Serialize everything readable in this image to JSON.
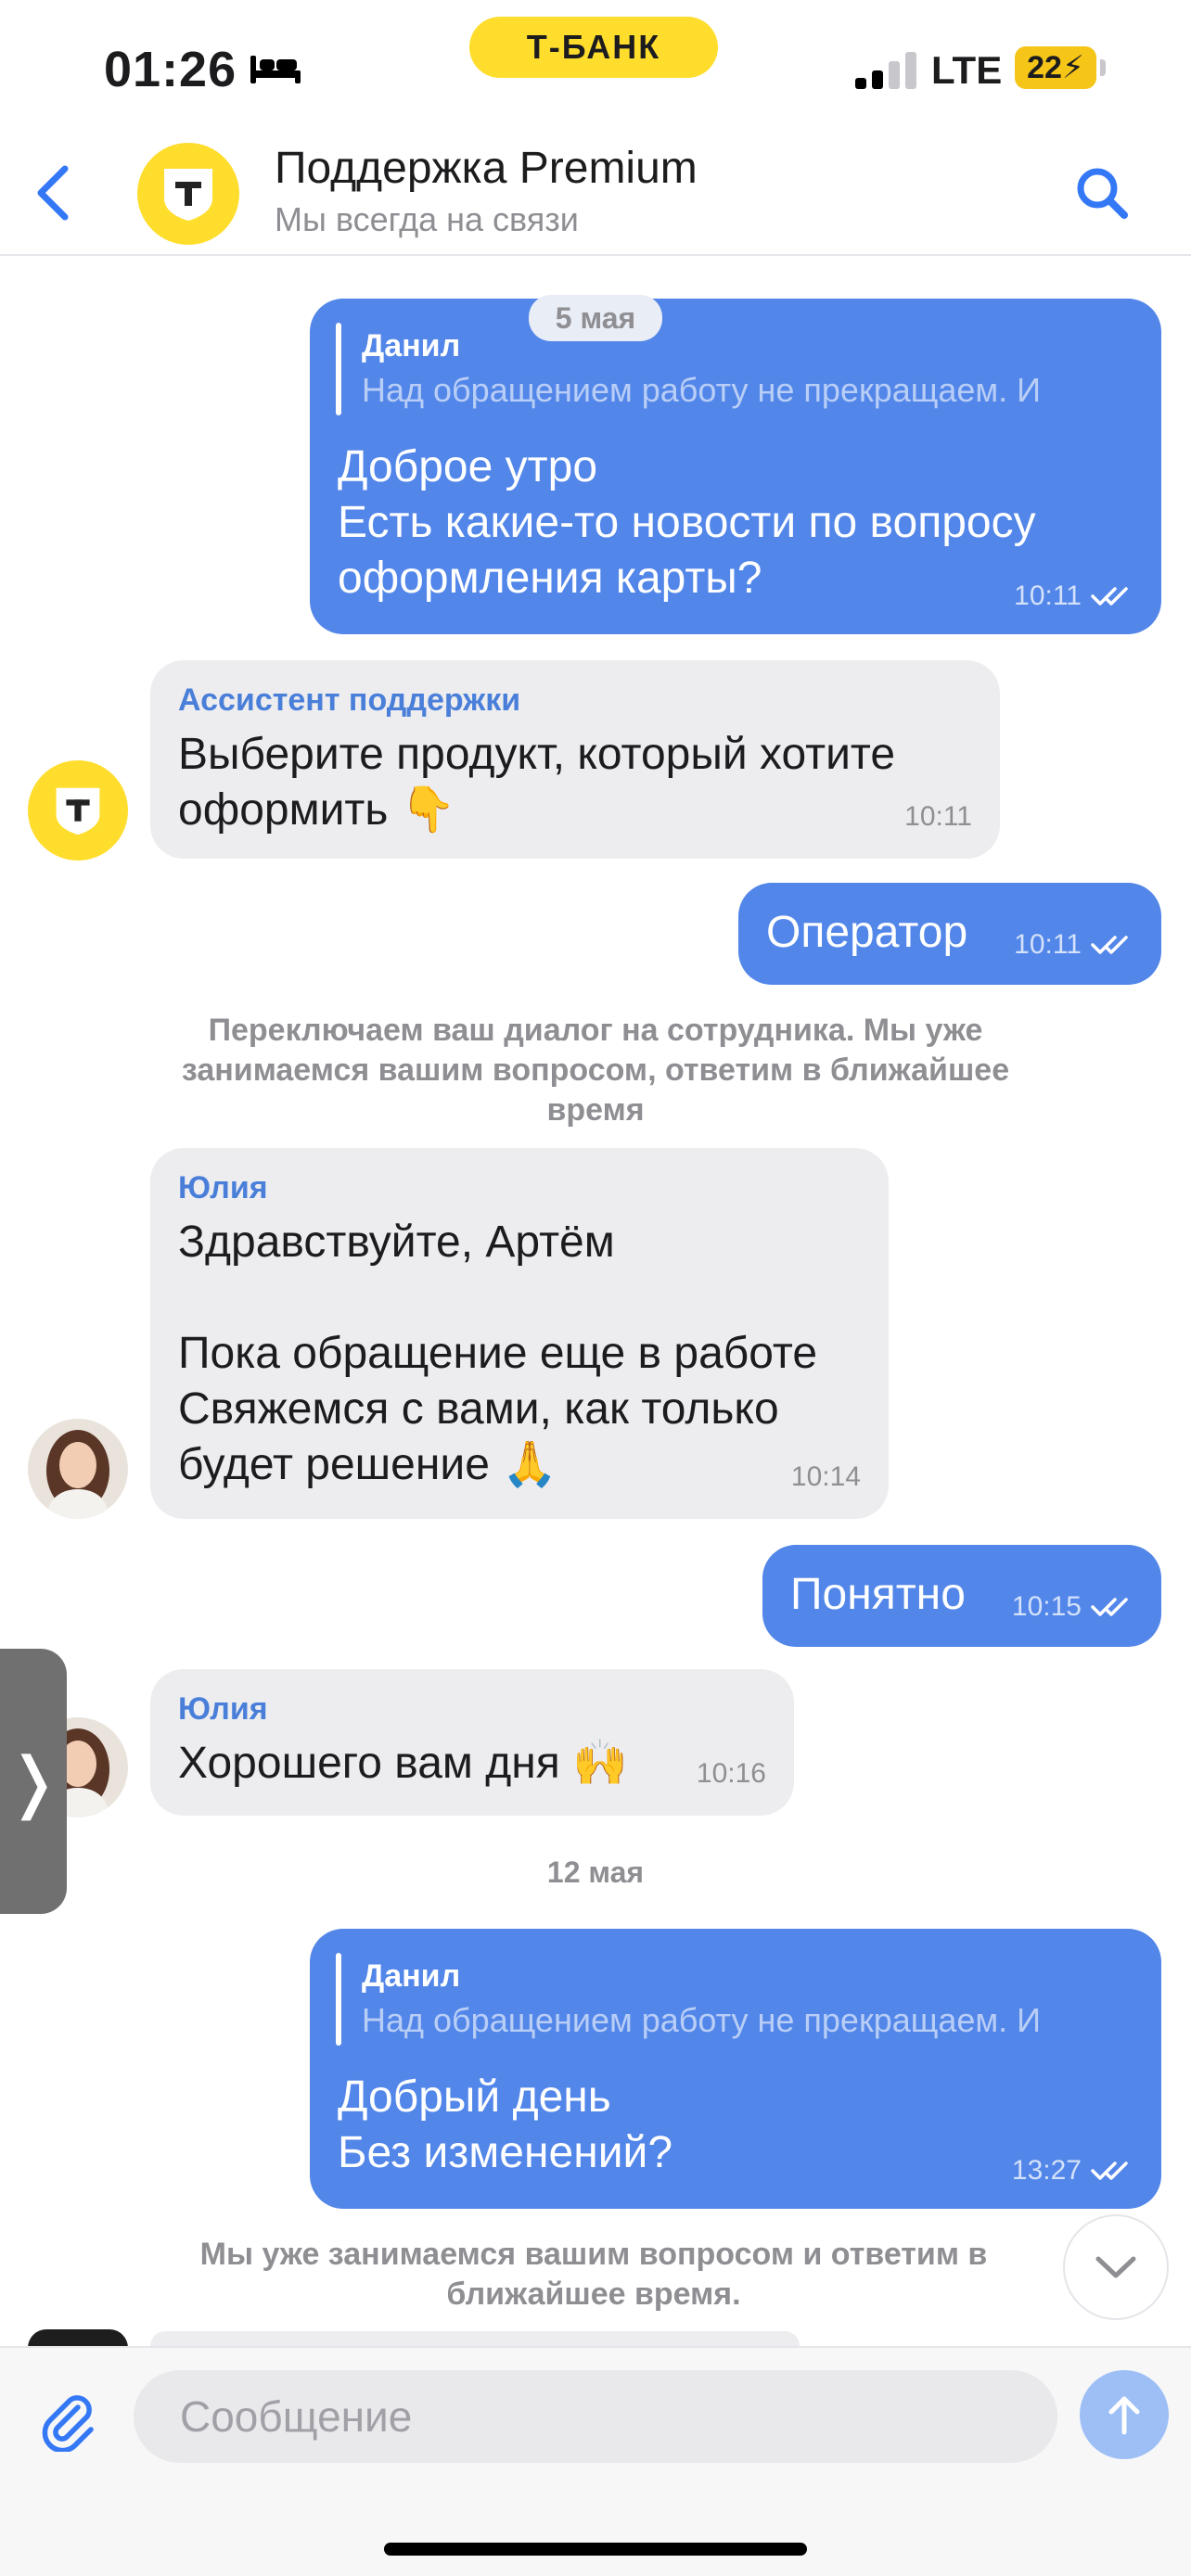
{
  "status_bar": {
    "time": "01:26",
    "bank": "Т-БАНК",
    "network": "LTE",
    "battery": "22"
  },
  "header": {
    "title": "Поддержка Premium",
    "subtitle": "Мы всегда на связи"
  },
  "messages": {
    "m1": {
      "reply_name": "Данил",
      "reply_text": "Над обращением работу не прекращаем. И",
      "date_chip": "5 мая",
      "text": "Доброе утро\nЕсть какие-то новости по вопросу\nоформления карты?",
      "time": "10:11"
    },
    "m2": {
      "sender": "Ассистент поддержки",
      "text": "Выберите продукт, который хотите\nоформить 👇",
      "time": "10:11"
    },
    "m3": {
      "text": "Оператор",
      "time": "10:11"
    },
    "sys1": "Переключаем ваш диалог на сотрудника. Мы уже занимаемся вашим вопросом, ответим в ближайшее время",
    "m4": {
      "sender": "Юлия",
      "text": "Здравствуйте, Артём\n\nПока обращение еще в работе\nСвяжемся с вами, как только\nбудет решение 🙏",
      "time": "10:14"
    },
    "m5": {
      "text": "Понятно",
      "time": "10:15"
    },
    "m6": {
      "sender": "Юлия",
      "text": "Хорошего вам дня 🙌",
      "time": "10:16"
    },
    "date2": "12 мая",
    "m7": {
      "reply_name": "Данил",
      "reply_text": "Над обращением работу не прекращаем. И",
      "text": "Добрый день\nБез изменений?",
      "time": "13:27"
    },
    "sys2": "Мы уже занимаемся вашим вопросом и ответим в ближайшее время."
  },
  "input": {
    "placeholder": "Сообщение"
  },
  "colors": {
    "outgoing_bubble": "#5286e9",
    "incoming_bubble": "#ededf0",
    "accent": "#4a7fd9",
    "brand_yellow": "#ffdd2d"
  },
  "icons": [
    "bed-icon",
    "signal-icon",
    "back-arrow-icon",
    "tbank-logo-icon",
    "search-icon",
    "double-check-icon",
    "chevron-right-icon",
    "chevron-down-icon",
    "paperclip-icon",
    "send-arrow-icon"
  ]
}
